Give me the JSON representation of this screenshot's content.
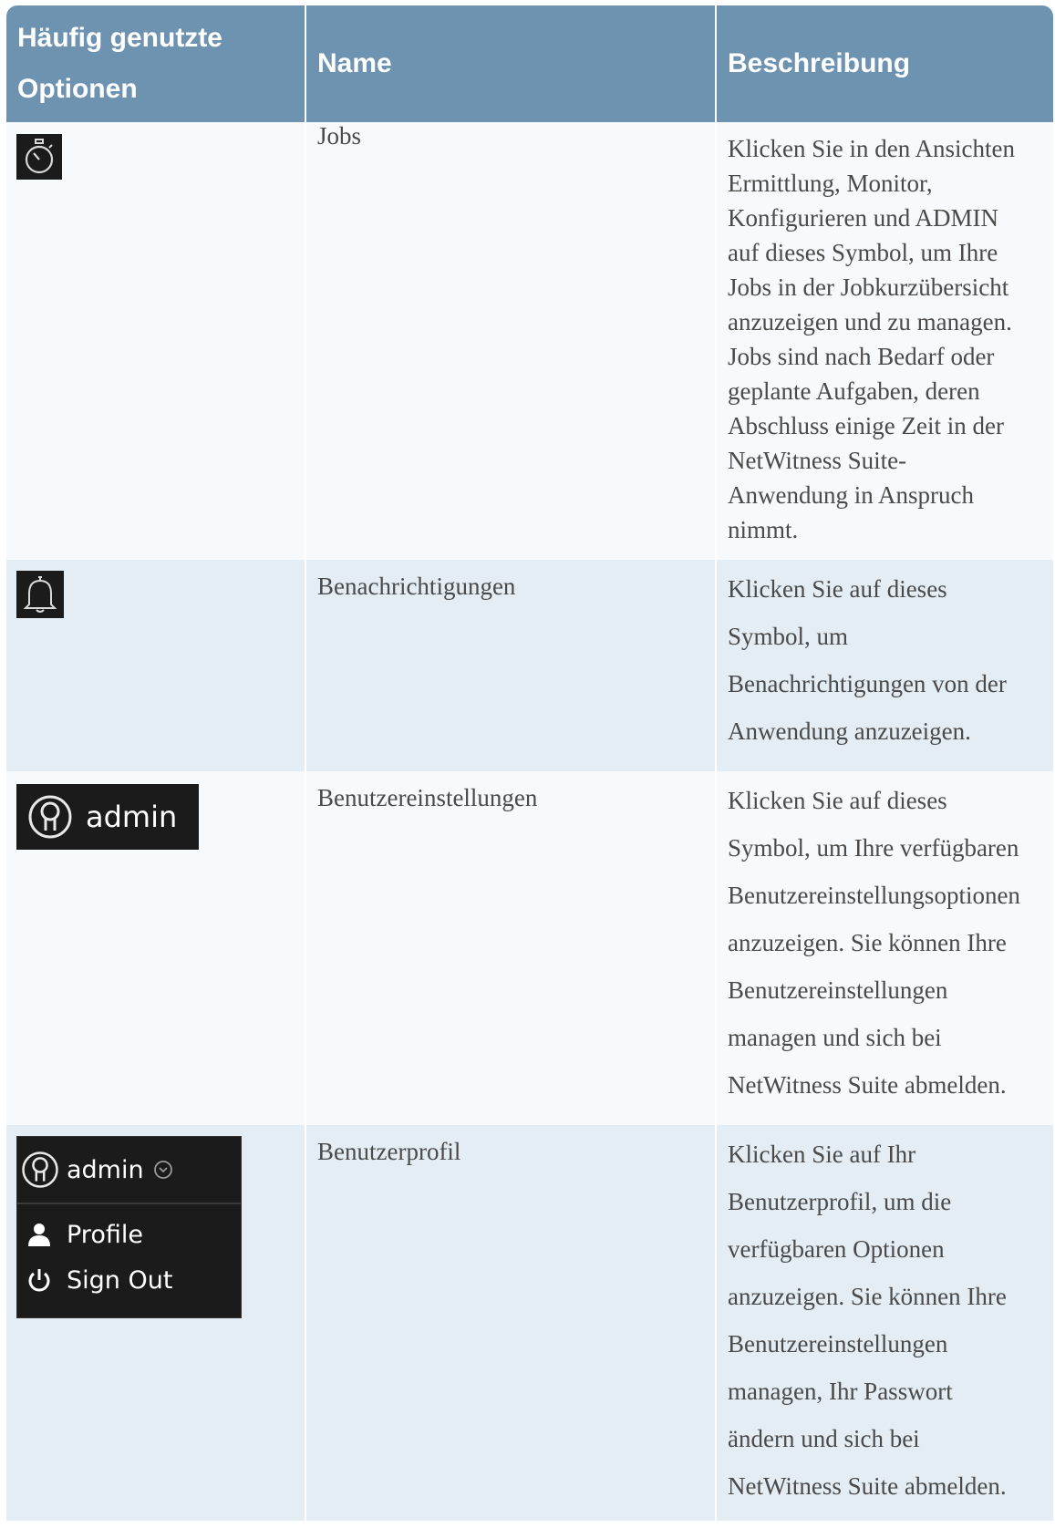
{
  "table": {
    "headers": [
      "Häufig genutzte Optionen",
      "Name",
      "Beschreibung"
    ],
    "header_lines": [
      "Häufig genutzte",
      "Optionen"
    ],
    "rows": [
      {
        "icon": "stopwatch-icon",
        "name": "Jobs",
        "description": "Klicken Sie in den Ansichten Ermittlung, Monitor, Konfigurieren und ADMIN auf dieses Symbol, um Ihre Jobs in der Jobkurzübersicht anzuzeigen und zu managen. Jobs sind nach Bedarf oder geplante Aufgaben, deren Abschluss einige Zeit in der NetWitness Suite-Anwendung in Anspruch nimmt.",
        "desc_lines": [
          "Klicken Sie in den Ansichten",
          "Ermittlung, Monitor,",
          "Konfigurieren und ADMIN",
          "auf dieses Symbol, um Ihre",
          "Jobs in der Jobkurzübersicht",
          "anzuzeigen und zu managen.",
          "Jobs sind nach Bedarf oder",
          "geplante Aufgaben, deren",
          "Abschluss einige Zeit in der",
          "NetWitness Suite-",
          "Anwendung in Anspruch",
          "nimmt."
        ]
      },
      {
        "icon": "bell-icon",
        "name": "Benachrichtigungen",
        "description": "Klicken Sie auf dieses Symbol, um Benachrichtigungen von der Anwendung anzuzeigen.",
        "desc_lines": [
          "Klicken Sie auf dieses",
          "Symbol, um",
          "Benachrichtigungen von der",
          "Anwendung anzuzeigen."
        ]
      },
      {
        "icon": "user-icon",
        "icon_label": "admin",
        "name": "Benutzereinstellungen",
        "description": "Klicken Sie auf dieses Symbol, um Ihre verfügbaren Benutzereinstellungsoptionen anzuzeigen. Sie können Ihre Benutzereinstellungen managen und sich bei NetWitness Suite abmelden.",
        "desc_lines": [
          "Klicken Sie auf dieses",
          "Symbol, um Ihre verfügbaren",
          "Benutzereinstellungsoptionen",
          "anzuzeigen. Sie können Ihre",
          "Benutzereinstellungen",
          "managen und sich bei",
          "NetWitness Suite abmelden."
        ]
      },
      {
        "icon": "user-icon",
        "menu": {
          "user": "admin",
          "items": [
            {
              "icon": "person-icon",
              "label": "Profile"
            },
            {
              "icon": "power-icon",
              "label": "Sign Out"
            }
          ]
        },
        "name": "Benutzerprofil",
        "description": "Klicken Sie auf Ihr Benutzerprofil, um die verfügbaren Optionen anzuzeigen. Sie können Ihre Benutzereinstellungen managen, Ihr Passwort ändern und sich bei NetWitness Suite abmelden.",
        "desc_lines": [
          "Klicken Sie auf Ihr",
          "Benutzerprofil, um die",
          "verfügbaren Optionen",
          "anzuzeigen. Sie können Ihre",
          "Benutzereinstellungen",
          "managen, Ihr Passwort",
          "ändern und sich bei",
          "NetWitness Suite abmelden."
        ]
      }
    ]
  }
}
